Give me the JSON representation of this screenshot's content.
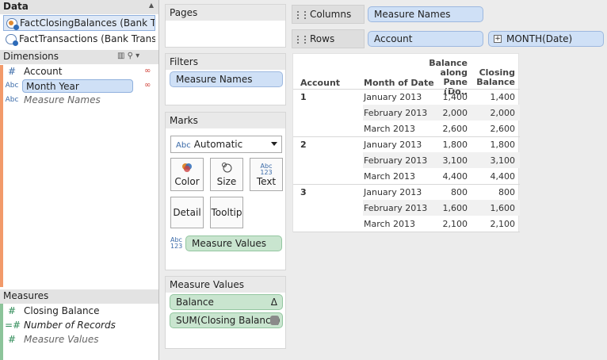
{
  "data_pane": {
    "title": "Data",
    "sources": [
      {
        "label": "FactClosingBalances (Bank Tra..."
      },
      {
        "label": "FactTransactions (Bank Transa..."
      }
    ]
  },
  "dimensions": {
    "header": "Dimensions",
    "fields": [
      {
        "type": "#",
        "label": "Account"
      },
      {
        "type": "Abc",
        "label": "Month Year"
      },
      {
        "type": "Abc",
        "label": "Measure Names"
      }
    ]
  },
  "measures": {
    "header": "Measures",
    "fields": [
      {
        "type": "#",
        "label": "Closing Balance"
      },
      {
        "type": "=#",
        "label": "Number of Records"
      },
      {
        "type": "#",
        "label": "Measure Values"
      }
    ]
  },
  "cards": {
    "pages": {
      "title": "Pages"
    },
    "filters": {
      "title": "Filters",
      "pills": [
        "Measure Names"
      ]
    },
    "marks": {
      "title": "Marks",
      "mark_type": "Automatic",
      "buttons": [
        "Color",
        "Size",
        "Text",
        "Detail",
        "Tooltip"
      ],
      "text_glyph": "Abc\n123",
      "measure_values_pill": "Measure Values"
    },
    "measure_values": {
      "title": "Measure Values",
      "pills": [
        "Balance",
        "SUM(Closing Balance)"
      ],
      "delta_symbol": "Δ"
    }
  },
  "shelves": {
    "columns": {
      "label": "Columns",
      "pills": [
        "Measure Names"
      ]
    },
    "rows": {
      "label": "Rows",
      "pills": [
        "Account",
        "MONTH(Date)"
      ]
    }
  },
  "table": {
    "headers": {
      "account": "Account",
      "month": "Month of Date",
      "balance_line1": "Balance",
      "balance_line2": "along",
      "balance_line3": "Pane (Do..",
      "closing_line1": "Closing",
      "closing_line2": "Balance"
    },
    "groups": [
      {
        "account": "1",
        "rows": [
          {
            "month": "January 2013",
            "balance": "1,400",
            "closing": "1,400"
          },
          {
            "month": "February 2013",
            "balance": "2,000",
            "closing": "2,000"
          },
          {
            "month": "March 2013",
            "balance": "2,600",
            "closing": "2,600"
          }
        ]
      },
      {
        "account": "2",
        "rows": [
          {
            "month": "January 2013",
            "balance": "1,800",
            "closing": "1,800"
          },
          {
            "month": "February 2013",
            "balance": "3,100",
            "closing": "3,100"
          },
          {
            "month": "March 2013",
            "balance": "4,400",
            "closing": "4,400"
          }
        ]
      },
      {
        "account": "3",
        "rows": [
          {
            "month": "January 2013",
            "balance": "800",
            "closing": "800"
          },
          {
            "month": "February 2013",
            "balance": "1,600",
            "closing": "1,600"
          },
          {
            "month": "March 2013",
            "balance": "2,100",
            "closing": "2,100"
          }
        ]
      }
    ]
  },
  "colors": {
    "pill_blue": "#cfe0f6",
    "pill_green": "#c9e5cf",
    "accent_stripe": "#f29a6a",
    "link_icon": "#d2473e"
  }
}
